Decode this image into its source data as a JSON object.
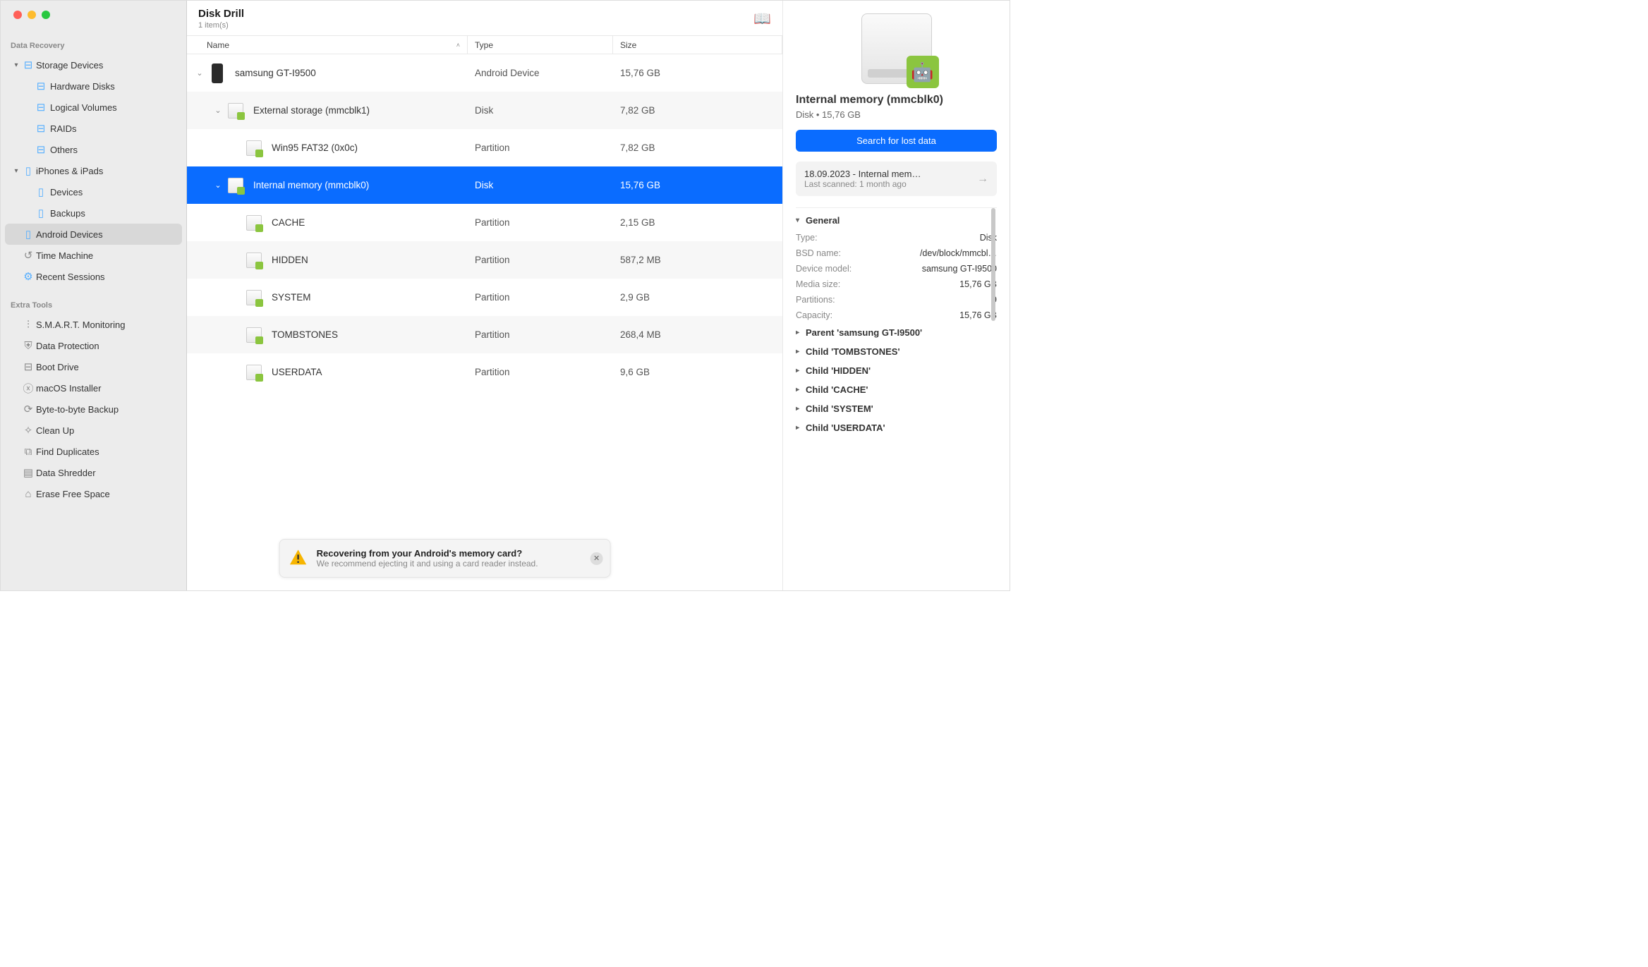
{
  "app": {
    "title": "Disk Drill",
    "subtitle": "1 item(s)"
  },
  "sidebar": {
    "section1": "Data Recovery",
    "storage_devices": "Storage Devices",
    "hardware_disks": "Hardware Disks",
    "logical_volumes": "Logical Volumes",
    "raids": "RAIDs",
    "others": "Others",
    "iphones_ipads": "iPhones & iPads",
    "devices": "Devices",
    "backups": "Backups",
    "android_devices": "Android Devices",
    "time_machine": "Time Machine",
    "recent_sessions": "Recent Sessions",
    "section2": "Extra Tools",
    "smart": "S.M.A.R.T. Monitoring",
    "data_protection": "Data Protection",
    "boot_drive": "Boot Drive",
    "macos_installer": "macOS Installer",
    "byte_backup": "Byte-to-byte Backup",
    "clean_up": "Clean Up",
    "find_duplicates": "Find Duplicates",
    "data_shredder": "Data Shredder",
    "erase_free_space": "Erase Free Space"
  },
  "columns": {
    "name": "Name",
    "type": "Type",
    "size": "Size"
  },
  "rows": [
    {
      "name": "samsung GT-I9500",
      "type": "Android Device",
      "size": "15,76 GB",
      "indent": 0,
      "expandable": true,
      "expanded": true,
      "icon": "phone"
    },
    {
      "name": "External storage (mmcblk1)",
      "type": "Disk",
      "size": "7,82 GB",
      "indent": 1,
      "expandable": true,
      "expanded": true,
      "icon": "drive",
      "striped": true
    },
    {
      "name": "Win95 FAT32 (0x0c)",
      "type": "Partition",
      "size": "7,82 GB",
      "indent": 2,
      "icon": "drive"
    },
    {
      "name": "Internal memory (mmcblk0)",
      "type": "Disk",
      "size": "15,76 GB",
      "indent": 1,
      "expandable": true,
      "expanded": true,
      "icon": "drive",
      "selected": true
    },
    {
      "name": "CACHE",
      "type": "Partition",
      "size": "2,15 GB",
      "indent": 2,
      "icon": "drive"
    },
    {
      "name": "HIDDEN",
      "type": "Partition",
      "size": "587,2 MB",
      "indent": 2,
      "icon": "drive",
      "striped": true
    },
    {
      "name": "SYSTEM",
      "type": "Partition",
      "size": "2,9 GB",
      "indent": 2,
      "icon": "drive"
    },
    {
      "name": "TOMBSTONES",
      "type": "Partition",
      "size": "268,4 MB",
      "indent": 2,
      "icon": "drive",
      "striped": true
    },
    {
      "name": "USERDATA",
      "type": "Partition",
      "size": "9,6 GB",
      "indent": 2,
      "icon": "drive"
    }
  ],
  "detail": {
    "title": "Internal memory (mmcblk0)",
    "subtitle": "Disk  •  15,76 GB",
    "scan_btn": "Search for lost data",
    "session_title": "18.09.2023 - Internal mem…",
    "session_sub": "Last scanned: 1 month ago",
    "general_label": "General",
    "kv": [
      {
        "k": "Type:",
        "v": "Disk"
      },
      {
        "k": "BSD name:",
        "v": "/dev/block/mmcbl…"
      },
      {
        "k": "Device model:",
        "v": "samsung GT-I9500"
      },
      {
        "k": "Media size:",
        "v": "15,76 GB"
      },
      {
        "k": "Partitions:",
        "v": "9"
      },
      {
        "k": "Capacity:",
        "v": "15,76 GB"
      }
    ],
    "children": [
      "Parent 'samsung GT-I9500'",
      "Child 'TOMBSTONES'",
      "Child 'HIDDEN'",
      "Child 'CACHE'",
      "Child 'SYSTEM'",
      "Child 'USERDATA'"
    ]
  },
  "toast": {
    "title": "Recovering from your Android's memory card?",
    "msg": "We recommend ejecting it and using a card reader instead."
  }
}
